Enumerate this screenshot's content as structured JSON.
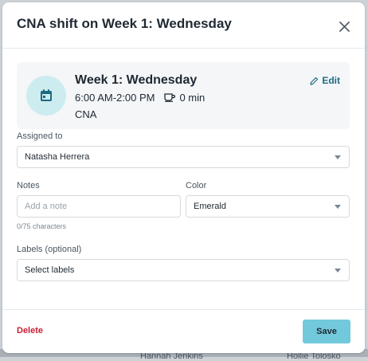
{
  "background": {
    "names": [
      "Hannah Jenkins",
      "Hollie Tolosko"
    ]
  },
  "dialog": {
    "title": "CNA shift on Week 1: Wednesday",
    "close_icon": "close-icon"
  },
  "summary": {
    "icon": "calendar-icon",
    "title": "Week 1: Wednesday",
    "time_range": "6:00 AM-2:00 PM",
    "break_icon": "coffee-icon",
    "break_duration": "0 min",
    "role": "CNA",
    "edit_label": "Edit",
    "edit_icon": "pencil-icon"
  },
  "form": {
    "assigned_to": {
      "label": "Assigned to",
      "value": "Natasha Herrera"
    },
    "notes": {
      "label": "Notes",
      "placeholder": "Add a note",
      "value": "",
      "char_count": "0/75 characters"
    },
    "color": {
      "label": "Color",
      "value": "Emerald"
    },
    "labels": {
      "label": "Labels (optional)",
      "placeholder": "Select labels"
    }
  },
  "footer": {
    "delete_label": "Delete",
    "save_label": "Save"
  },
  "colors": {
    "accent": "#72c9db",
    "link": "#1d6b80",
    "danger": "#c81e35",
    "icon_circle": "#cdecf0"
  }
}
